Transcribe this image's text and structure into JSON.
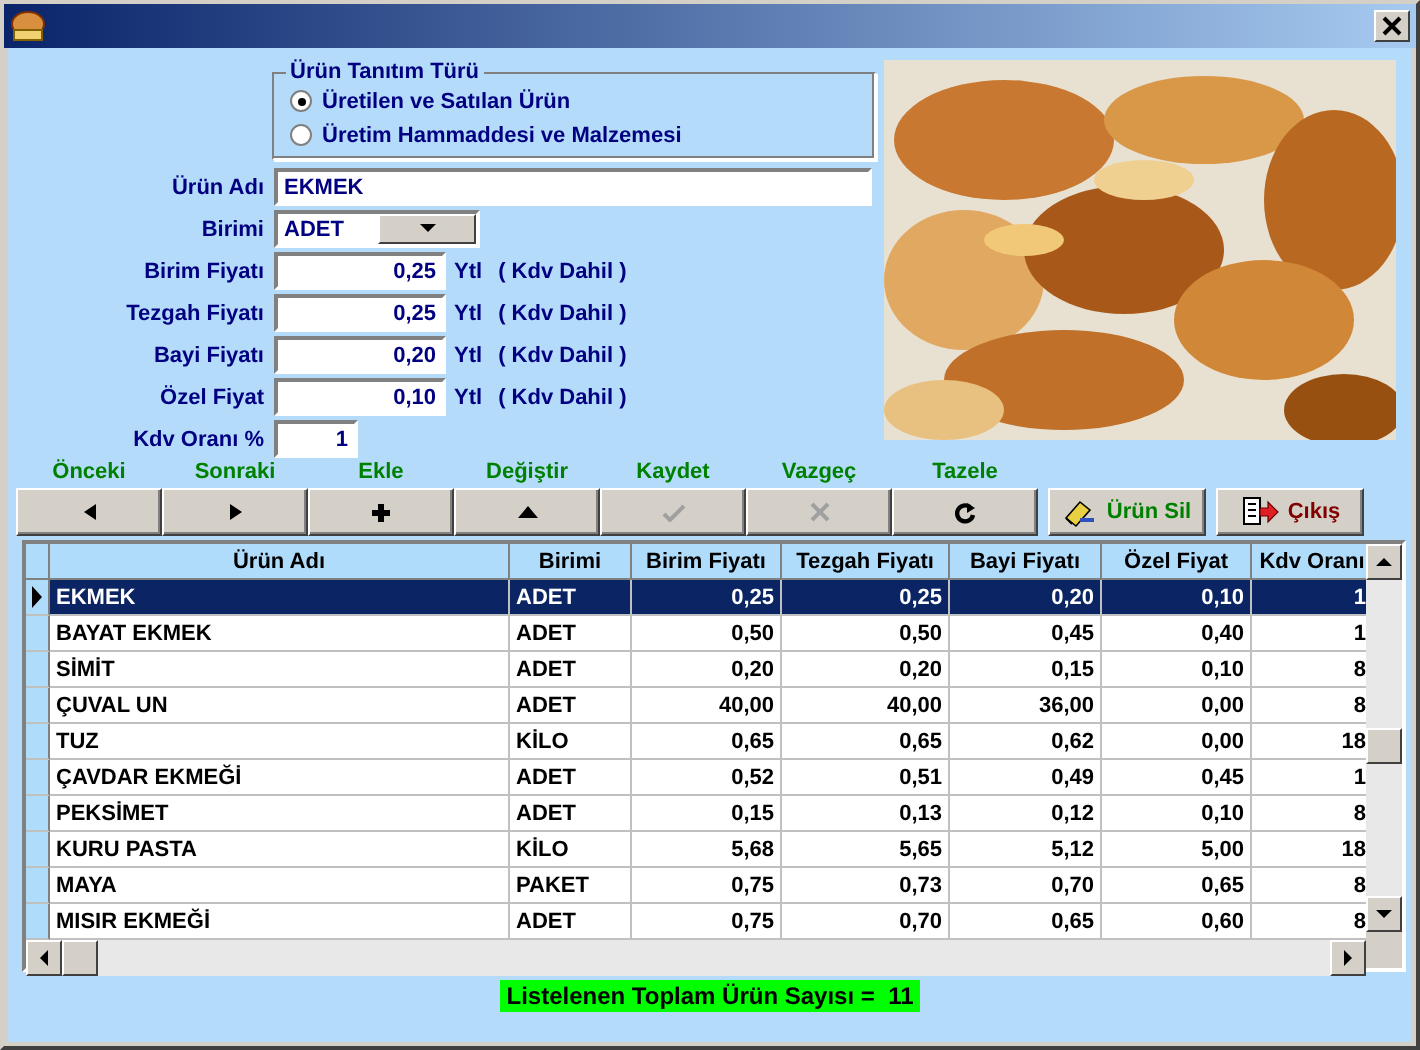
{
  "product_type": {
    "title": "Ürün Tanıtım Türü",
    "options": [
      {
        "label": "Üretilen ve Satılan Ürün",
        "selected": true
      },
      {
        "label": "Üretim Hammaddesi ve Malzemesi",
        "selected": false
      }
    ]
  },
  "fields": [
    {
      "kind": "text",
      "label": "Ürün Adı",
      "value": "EKMEK"
    },
    {
      "kind": "combo",
      "label": "Birimi",
      "value": "ADET"
    },
    {
      "kind": "price",
      "label": "Birim Fiyatı",
      "value": "0,25",
      "unit": "Ytl",
      "note": "( Kdv Dahil )"
    },
    {
      "kind": "price",
      "label": "Tezgah Fiyatı",
      "value": "0,25",
      "unit": "Ytl",
      "note": "( Kdv Dahil )"
    },
    {
      "kind": "price",
      "label": "Bayi Fiyatı",
      "value": "0,20",
      "unit": "Ytl",
      "note": "( Kdv Dahil )"
    },
    {
      "kind": "price",
      "label": "Özel Fiyat",
      "value": "0,10",
      "unit": "Ytl",
      "note": "( Kdv Dahil )"
    },
    {
      "kind": "number",
      "label": "Kdv Oranı %",
      "value": "1"
    }
  ],
  "nav_buttons": [
    {
      "kind": "prev",
      "caption": "Önceki",
      "disabled": false
    },
    {
      "kind": "next",
      "caption": "Sonraki",
      "disabled": false
    },
    {
      "kind": "add",
      "caption": "Ekle",
      "disabled": false
    },
    {
      "kind": "edit",
      "caption": "Değiştir",
      "disabled": false
    },
    {
      "kind": "save",
      "caption": "Kaydet",
      "disabled": true
    },
    {
      "kind": "cancel",
      "caption": "Vazgeç",
      "disabled": true
    },
    {
      "kind": "refresh",
      "caption": "Tazele",
      "disabled": false
    }
  ],
  "action_buttons": [
    {
      "kind": "delete",
      "label": "Ürün Sil"
    },
    {
      "kind": "exit",
      "label": "Çıkış"
    }
  ],
  "table": {
    "columns": [
      {
        "label": "Ürün Adı",
        "kind": "text"
      },
      {
        "label": "Birimi",
        "kind": "text"
      },
      {
        "label": "Birim Fiyatı",
        "kind": "number"
      },
      {
        "label": "Tezgah Fiyatı",
        "kind": "number"
      },
      {
        "label": "Bayi Fiyatı",
        "kind": "number"
      },
      {
        "label": "Özel Fiyat",
        "kind": "number"
      },
      {
        "label": "Kdv Oranı",
        "kind": "number"
      }
    ],
    "rows": [
      {
        "selected": true,
        "cells": [
          "EKMEK",
          "ADET",
          "0,25",
          "0,25",
          "0,20",
          "0,10",
          "1"
        ]
      },
      {
        "selected": false,
        "cells": [
          "BAYAT EKMEK",
          "ADET",
          "0,50",
          "0,50",
          "0,45",
          "0,40",
          "1"
        ]
      },
      {
        "selected": false,
        "cells": [
          "SİMİT",
          "ADET",
          "0,20",
          "0,20",
          "0,15",
          "0,10",
          "8"
        ]
      },
      {
        "selected": false,
        "cells": [
          "ÇUVAL UN",
          "ADET",
          "40,00",
          "40,00",
          "36,00",
          "0,00",
          "8"
        ]
      },
      {
        "selected": false,
        "cells": [
          "TUZ",
          "KİLO",
          "0,65",
          "0,65",
          "0,62",
          "0,00",
          "18"
        ]
      },
      {
        "selected": false,
        "cells": [
          "ÇAVDAR EKMEĞİ",
          "ADET",
          "0,52",
          "0,51",
          "0,49",
          "0,45",
          "1"
        ]
      },
      {
        "selected": false,
        "cells": [
          "PEKSİMET",
          "ADET",
          "0,15",
          "0,13",
          "0,12",
          "0,10",
          "8"
        ]
      },
      {
        "selected": false,
        "cells": [
          "KURU PASTA",
          "KİLO",
          "5,68",
          "5,65",
          "5,12",
          "5,00",
          "18"
        ]
      },
      {
        "selected": false,
        "cells": [
          "MAYA",
          "PAKET",
          "0,75",
          "0,73",
          "0,70",
          "0,65",
          "8"
        ]
      },
      {
        "selected": false,
        "cells": [
          "MISIR EKMEĞİ",
          "ADET",
          "0,75",
          "0,70",
          "0,65",
          "0,60",
          "8"
        ]
      }
    ]
  },
  "status": "Listelenen Toplam Ürün Sayısı =  11"
}
